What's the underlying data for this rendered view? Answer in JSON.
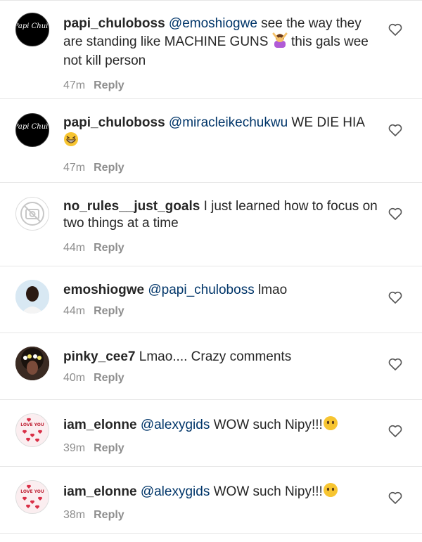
{
  "comments": [
    {
      "username": "papi_chuloboss",
      "mention": "@emoshiogwe",
      "text": " see the way they are standing like MACHINE GUNS ",
      "emoji_after": "person-gesturing-no",
      "text2": " this gals wee not kill person",
      "time": "47m",
      "reply": "Reply",
      "avatar": "papi-chulo-logo",
      "avatar_text": "Papi Chulo"
    },
    {
      "username": "papi_chuloboss",
      "mention": "@miracleikechukwu",
      "text": " WE DIE HIA ",
      "emoji_after": "grinning-squinting-face",
      "text2": "",
      "time": "47m",
      "reply": "Reply",
      "avatar": "papi-chulo-logo",
      "avatar_text": "Papi Chulo"
    },
    {
      "username": "no_rules__just_goals",
      "mention": "",
      "text": " I just learned how to focus on two things at a time",
      "emoji_after": "",
      "text2": "",
      "time": "44m",
      "reply": "Reply",
      "avatar": "no-photo-icon"
    },
    {
      "username": "emoshiogwe",
      "mention": "@papi_chuloboss",
      "text": " lmao",
      "emoji_after": "",
      "text2": "",
      "time": "44m",
      "reply": "Reply",
      "avatar": "user-photo"
    },
    {
      "username": "pinky_cee7",
      "mention": "",
      "text": " Lmao.... Crazy comments",
      "emoji_after": "",
      "text2": "",
      "time": "40m",
      "reply": "Reply",
      "avatar": "user-photo"
    },
    {
      "username": "iam_elonne",
      "mention": "@alexygids",
      "text": " WOW such Nipy!!!",
      "emoji_after": "face-without-mouth",
      "text2": "",
      "time": "39m",
      "reply": "Reply",
      "avatar": "love-hearts-photo",
      "avatar_text": "LOVE YOU"
    },
    {
      "username": "iam_elonne",
      "mention": "@alexygids",
      "text": " WOW such Nipy!!!",
      "emoji_after": "face-without-mouth",
      "text2": "",
      "time": "38m",
      "reply": "Reply",
      "avatar": "love-hearts-photo",
      "avatar_text": "LOVE YOU"
    }
  ],
  "colors": {
    "username": "#262626",
    "mention": "#003569",
    "meta": "#8e8e8e",
    "divider": "#e6e6e6"
  }
}
